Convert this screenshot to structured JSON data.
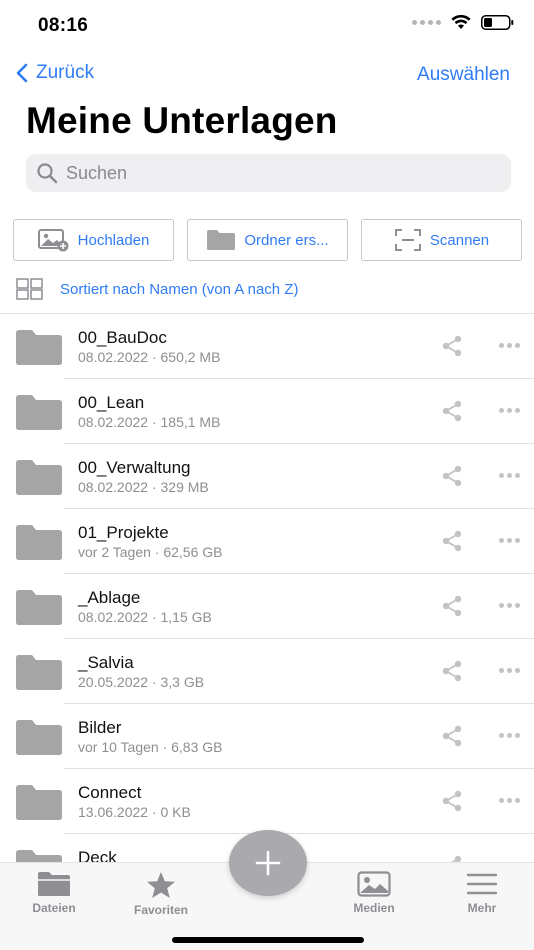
{
  "status_bar": {
    "time": "08:16"
  },
  "nav": {
    "back_label": "Zurück",
    "select_label": "Auswählen"
  },
  "page": {
    "title": "Meine Unterlagen"
  },
  "search": {
    "placeholder": "Suchen"
  },
  "actions": [
    {
      "label": "Hochladen",
      "icon": "upload-image-icon"
    },
    {
      "label": "Ordner ers...",
      "icon": "folder-icon"
    },
    {
      "label": "Scannen",
      "icon": "scan-icon"
    }
  ],
  "sort": {
    "label": "Sortiert nach Namen (von A nach Z)"
  },
  "files": [
    {
      "name": "00_BauDoc",
      "meta": "08.02.2022 · 650,2 MB"
    },
    {
      "name": "00_Lean",
      "meta": "08.02.2022 · 185,1 MB"
    },
    {
      "name": "00_Verwaltung",
      "meta": "08.02.2022 · 329 MB"
    },
    {
      "name": "01_Projekte",
      "meta": "vor 2 Tagen · 62,56 GB"
    },
    {
      "name": "_Ablage",
      "meta": "08.02.2022 · 1,15 GB"
    },
    {
      "name": "_Salvia",
      "meta": "20.05.2022 · 3,3 GB"
    },
    {
      "name": "Bilder",
      "meta": "vor 10 Tagen · 6,83 GB"
    },
    {
      "name": "Connect",
      "meta": "13.06.2022 · 0 KB"
    },
    {
      "name": "Deck",
      "meta": ""
    }
  ],
  "tabs": [
    {
      "label": "Dateien",
      "icon": "folder-icon"
    },
    {
      "label": "Favoriten",
      "icon": "star-icon"
    },
    {
      "label": "Medien",
      "icon": "image-icon"
    },
    {
      "label": "Mehr",
      "icon": "menu-icon"
    }
  ],
  "colors": {
    "accent": "#2f7cf6",
    "folder": "#a5a5a5",
    "icon_gray": "#c2c2c7",
    "tab_gray": "#8e8e93"
  }
}
